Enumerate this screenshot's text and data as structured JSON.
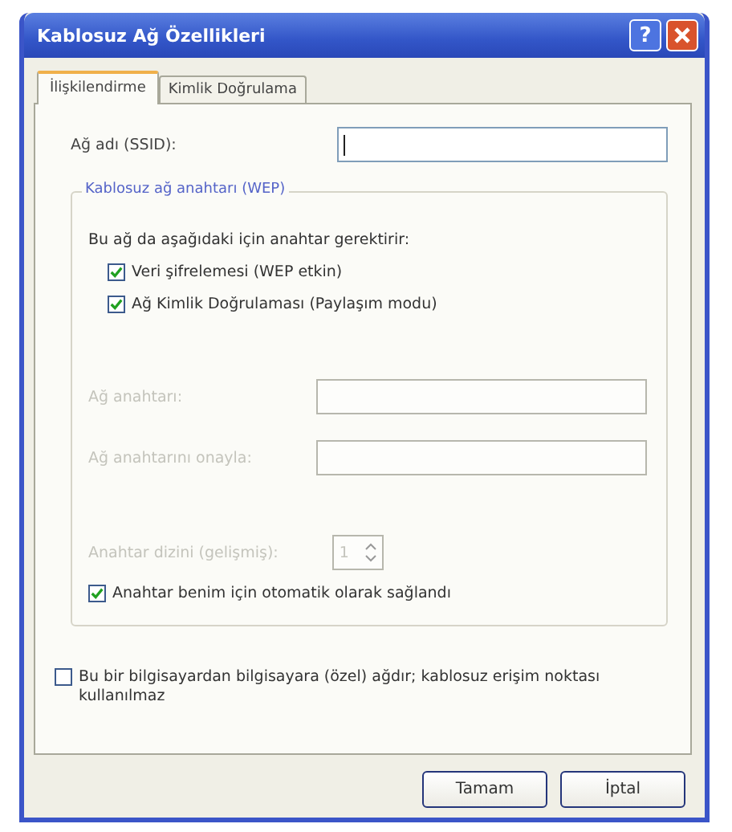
{
  "window": {
    "title": "Kablosuz Ağ Özellikleri",
    "help_button": "?"
  },
  "tabs": [
    {
      "label": "İlişkilendirme",
      "selected": true
    },
    {
      "label": "Kimlik Doğrulama",
      "selected": false
    }
  ],
  "ssid": {
    "label": "Ağ adı (SSID):",
    "disabled": false
  },
  "wep_group": {
    "title": "Kablosuz ağ anahtarı (WEP)",
    "intro": "Bu ağ da aşağıdaki için anahtar gerektirir:",
    "options": [
      {
        "label": "Veri şifrelemesi (WEP etkin)",
        "checked": true
      },
      {
        "label": "Ağ Kimlik Doğrulaması (Paylaşım modu)",
        "checked": true
      }
    ],
    "fields": [
      {
        "label": "Ağ anahtarı:",
        "disabled": true
      },
      {
        "label": "Ağ anahtarını onayla:",
        "disabled": true
      }
    ],
    "key_index": {
      "label": "Anahtar dizini (gelişmiş):",
      "value": "1",
      "disabled": true
    },
    "auto_key": {
      "label": "Anahtar benim için otomatik olarak sağlandı",
      "checked": true
    }
  },
  "adhoc": {
    "label": "Bu bir bilgisayardan bilgisayara (özel) ağdır; kablosuz erişim noktası kullanılmaz",
    "checked": false
  },
  "buttons": [
    "Tamam",
    "İptal"
  ]
}
